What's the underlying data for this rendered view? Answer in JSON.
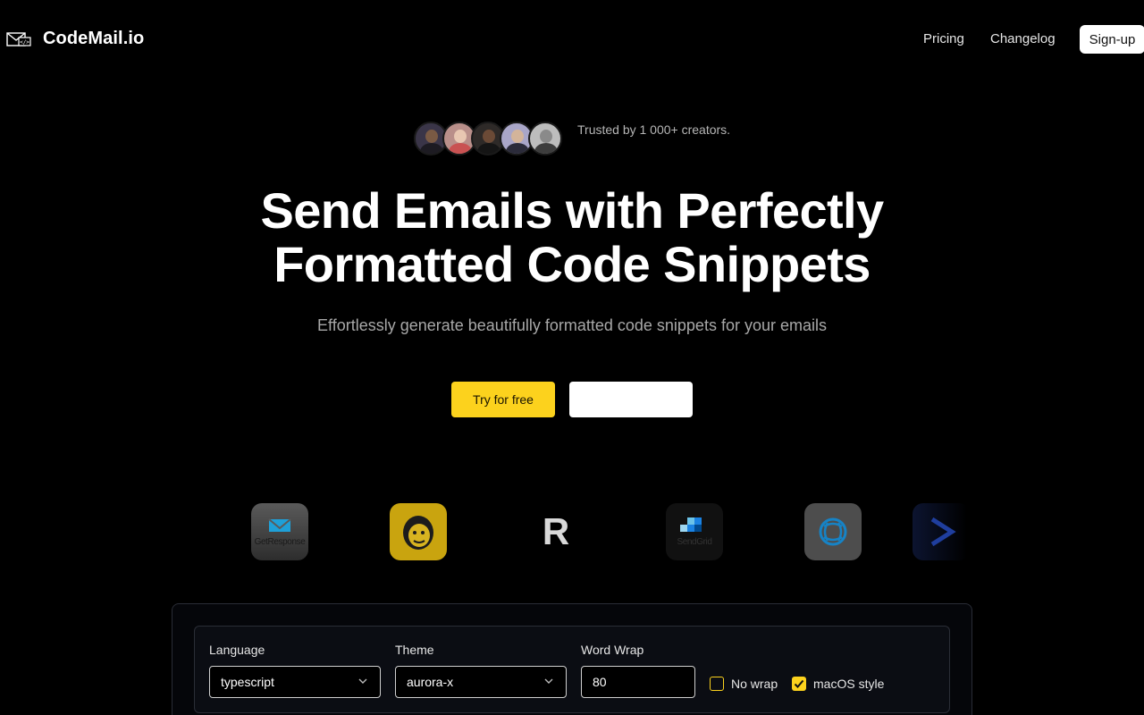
{
  "header": {
    "brand_name": "CodeMail.io",
    "brand_icon": "envelope-code-icon",
    "nav": {
      "pricing": "Pricing",
      "changelog": "Changelog"
    },
    "signup_label": "Sign-up"
  },
  "social_proof": {
    "trusted_text": "Trusted by 1 000+ creators.",
    "avatar_count": 5
  },
  "hero": {
    "title_line1": "Send Emails with Perfectly",
    "title_line2": "Formatted Code Snippets",
    "subtitle": "Effortlessly generate beautifully formatted code snippets for your emails",
    "cta_primary": "Try for free",
    "cta_secondary": ""
  },
  "logos": {
    "getresponse": "GetResponse",
    "mailchimp": "mailchimp-icon",
    "r": "R",
    "sendgrid": "SendGrid",
    "sendinblue": "sendinblue-icon",
    "activecampaign": "activecampaign-icon"
  },
  "editor_options": {
    "language_label": "Language",
    "language_value": "typescript",
    "theme_label": "Theme",
    "theme_value": "aurora-x",
    "word_wrap_label": "Word Wrap",
    "word_wrap_value": "80",
    "no_wrap_label": "No wrap",
    "no_wrap_checked": false,
    "macos_label": "macOS style",
    "macos_checked": true
  },
  "colors": {
    "accent": "#fcd21d",
    "background": "#000000",
    "panel_border": "#2a2d36"
  }
}
